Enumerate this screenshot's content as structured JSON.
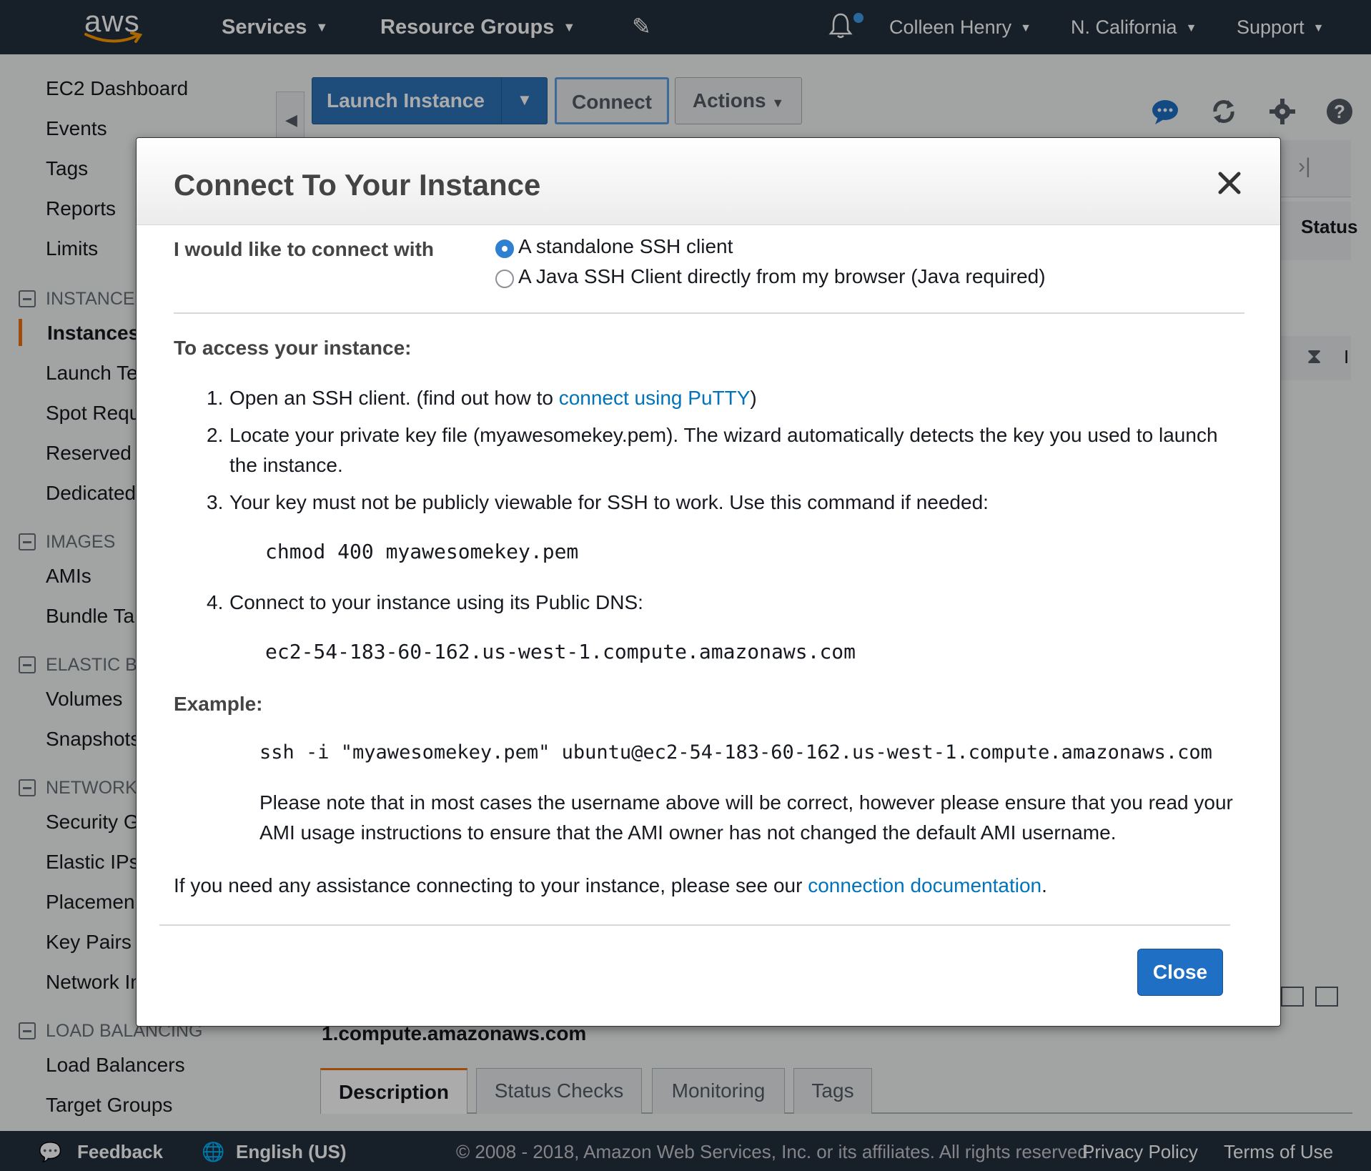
{
  "topnav": {
    "logo": "aws",
    "services": "Services",
    "resource_groups": "Resource Groups",
    "pin_icon": "pin-icon",
    "bell_icon": "bell-icon",
    "user": "Colleen Henry",
    "region": "N. California",
    "support": "Support"
  },
  "sidebar": {
    "items_top": [
      "EC2 Dashboard",
      "Events",
      "Tags",
      "Reports",
      "Limits"
    ],
    "sections": [
      {
        "title": "INSTANCES",
        "items": [
          "Instances",
          "Launch Te",
          "Spot Requ",
          "Reserved",
          "Dedicated"
        ]
      },
      {
        "title": "IMAGES",
        "items": [
          "AMIs",
          "Bundle Ta"
        ]
      },
      {
        "title": "ELASTIC BL",
        "items": [
          "Volumes",
          "Snapshots"
        ]
      },
      {
        "title": "NETWORK",
        "items": [
          "Security G",
          "Elastic IPs",
          "Placemen",
          "Key Pairs",
          "Network In"
        ]
      },
      {
        "title": "LOAD BALANCING",
        "items": [
          "Load Balancers",
          "Target Groups"
        ]
      }
    ],
    "active_item": "Instances"
  },
  "toolbar": {
    "launch_instance": "Launch Instance",
    "connect": "Connect",
    "actions": "Actions"
  },
  "background": {
    "status_header": "Status",
    "dns_fragment": "1.compute.amazonaws.com",
    "row_fragment": "I",
    "tabs": [
      "Description",
      "Status Checks",
      "Monitoring",
      "Tags"
    ]
  },
  "modal": {
    "title": "Connect To Your Instance",
    "connect_with_label": "I would like to connect with",
    "option_standalone": "A standalone SSH client",
    "option_java": "A Java SSH Client directly from my browser (Java required)",
    "access_heading": "To access your instance:",
    "steps": [
      {
        "num": "1.",
        "text": "Open an SSH client. (find out how to ",
        "link": "connect using PuTTY",
        "after": ")"
      },
      {
        "num": "2.",
        "text": "Locate your private key file (myawesomekey.pem). The wizard automatically detects the key you used to launch",
        "text2": "the instance."
      },
      {
        "num": "3.",
        "text": "Your key must not be publicly viewable for SSH to work. Use this command if needed:"
      },
      {
        "num": "4.",
        "text": "Connect to your instance using its Public DNS:"
      }
    ],
    "chmod_command": "chmod 400 myawesomekey.pem",
    "public_dns": "ec2-54-183-60-162.us-west-1.compute.amazonaws.com",
    "example_heading": "Example:",
    "example_command": "ssh -i \"myawesomekey.pem\" ubuntu@ec2-54-183-60-162.us-west-1.compute.amazonaws.com",
    "note_line1": "Please note that in most cases the username above will be correct, however please ensure that you read your",
    "note_line2": "AMI usage instructions to ensure that the AMI owner has not changed the default AMI username.",
    "assist_text": "If you need any assistance connecting to your instance, please see our ",
    "assist_link": "connection documentation",
    "assist_end": ".",
    "close_button": "Close"
  },
  "footer": {
    "feedback": "Feedback",
    "language": "English (US)",
    "copyright": "© 2008 - 2018, Amazon Web Services, Inc. or its affiliates. All rights reserved.",
    "privacy": "Privacy Policy",
    "terms": "Terms of Use"
  },
  "colors": {
    "nav_bg": "#232f3e",
    "primary_blue": "#2e73b8",
    "link": "#0073bb",
    "active_accent": "#ec7211"
  }
}
